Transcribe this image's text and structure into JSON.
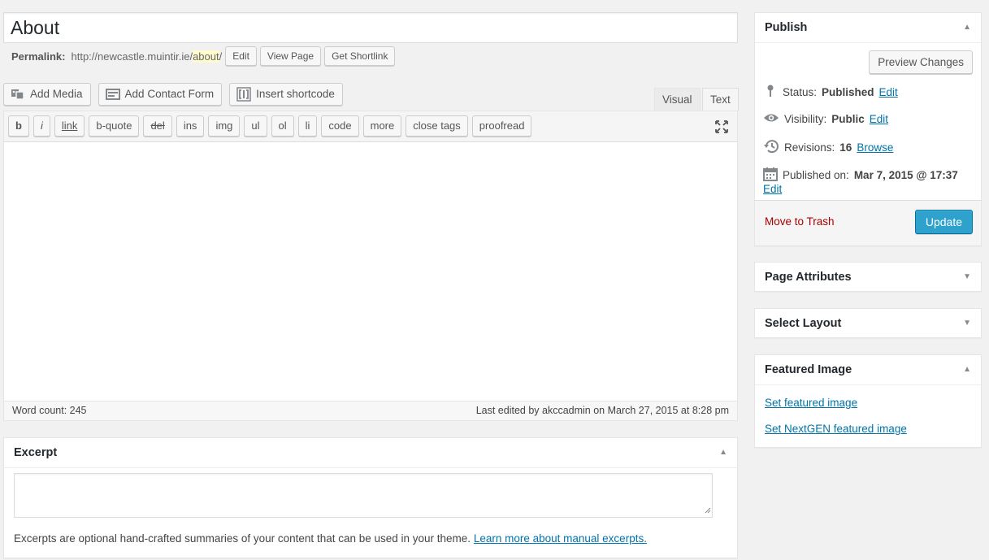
{
  "title": {
    "value": "About"
  },
  "permalink": {
    "label": "Permalink:",
    "base": "http://newcastle.muintir.ie/",
    "slug": "about",
    "trailing": "/",
    "buttons": {
      "edit": "Edit",
      "view": "View Page",
      "shortlink": "Get Shortlink"
    }
  },
  "media_buttons": {
    "add_media": "Add Media",
    "add_contact_form": "Add Contact Form",
    "insert_shortcode": "Insert shortcode"
  },
  "editor_tabs": {
    "visual": "Visual",
    "text": "Text"
  },
  "quicktags": [
    "b",
    "i",
    "link",
    "b-quote",
    "del",
    "ins",
    "img",
    "ul",
    "ol",
    "li",
    "code",
    "more",
    "close tags",
    "proofread"
  ],
  "status_bar": {
    "word_count": "Word count: 245",
    "last_edited": "Last edited by akccadmin on March 27, 2015 at 8:28 pm"
  },
  "excerpt": {
    "title": "Excerpt",
    "description": "Excerpts are optional hand-crafted summaries of your content that can be used in your theme.",
    "learn_more": "Learn more about manual excerpts."
  },
  "publish": {
    "title": "Publish",
    "preview_button": "Preview Changes",
    "status_label": "Status:",
    "status_value": "Published",
    "visibility_label": "Visibility:",
    "visibility_value": "Public",
    "revisions_label": "Revisions:",
    "revisions_value": "16",
    "browse": "Browse",
    "published_label": "Published on:",
    "published_value": "Mar 7, 2015 @ 17:37",
    "edit": "Edit",
    "trash": "Move to Trash",
    "update": "Update"
  },
  "page_attributes": {
    "title": "Page Attributes"
  },
  "select_layout": {
    "title": "Select Layout"
  },
  "featured_image": {
    "title": "Featured Image",
    "set_featured": "Set featured image",
    "set_nextgen": "Set NextGEN featured image"
  },
  "colors": {
    "link": "#0073aa",
    "primary_button": "#2ea2cc",
    "trash": "#aa0000",
    "background": "#f1f1f1"
  },
  "icons": [
    "media-icon",
    "form-icon",
    "shortcode-icon",
    "fullscreen-icon",
    "pin-icon",
    "eye-icon",
    "history-icon",
    "calendar-icon"
  ]
}
